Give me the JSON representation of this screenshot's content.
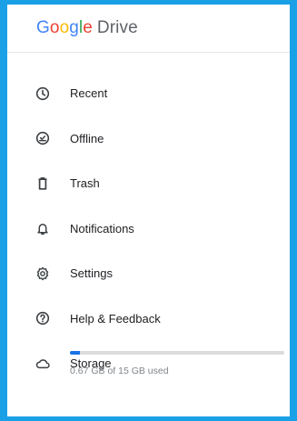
{
  "app": {
    "logo_letters": [
      "G",
      "o",
      "o",
      "g",
      "l",
      "e"
    ],
    "product": "Drive"
  },
  "menu": [
    {
      "label": "Recent",
      "icon": "clock-icon"
    },
    {
      "label": "Offline",
      "icon": "offline-check-icon"
    },
    {
      "label": "Trash",
      "icon": "trash-icon"
    },
    {
      "label": "Notifications",
      "icon": "bell-icon"
    },
    {
      "label": "Settings",
      "icon": "gear-icon"
    },
    {
      "label": "Help & Feedback",
      "icon": "help-icon"
    },
    {
      "label": "Storage",
      "icon": "cloud-icon"
    }
  ],
  "storage": {
    "used_text": "0.67 GB of 15 GB used",
    "used_fraction": 0.045,
    "bar_color": "#1a73e8"
  }
}
